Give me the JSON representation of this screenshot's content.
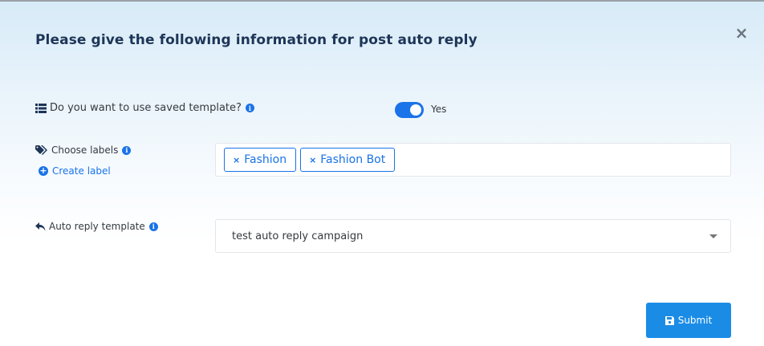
{
  "modal": {
    "title": "Please give the following information for post auto reply",
    "close_label": "×"
  },
  "saved_template": {
    "label": "Do you want to use saved template?",
    "toggle_on": true,
    "toggle_text": "Yes"
  },
  "labels": {
    "label": "Choose labels",
    "create_label": "Create label",
    "tags": [
      {
        "name": "Fashion",
        "remove": "×"
      },
      {
        "name": "Fashion Bot",
        "remove": "×"
      }
    ]
  },
  "auto_reply": {
    "label": "Auto reply template",
    "selected": "test auto reply campaign"
  },
  "submit": {
    "label": "Submit"
  },
  "icons": {
    "list": "list-icon",
    "tags": "tags-icon",
    "reply": "reply-icon",
    "info": "info-icon",
    "plus": "plus-circle-icon",
    "save": "save-icon"
  },
  "colors": {
    "accent": "#1a73e8",
    "submit": "#1a8ce6",
    "title": "#1d3557"
  }
}
